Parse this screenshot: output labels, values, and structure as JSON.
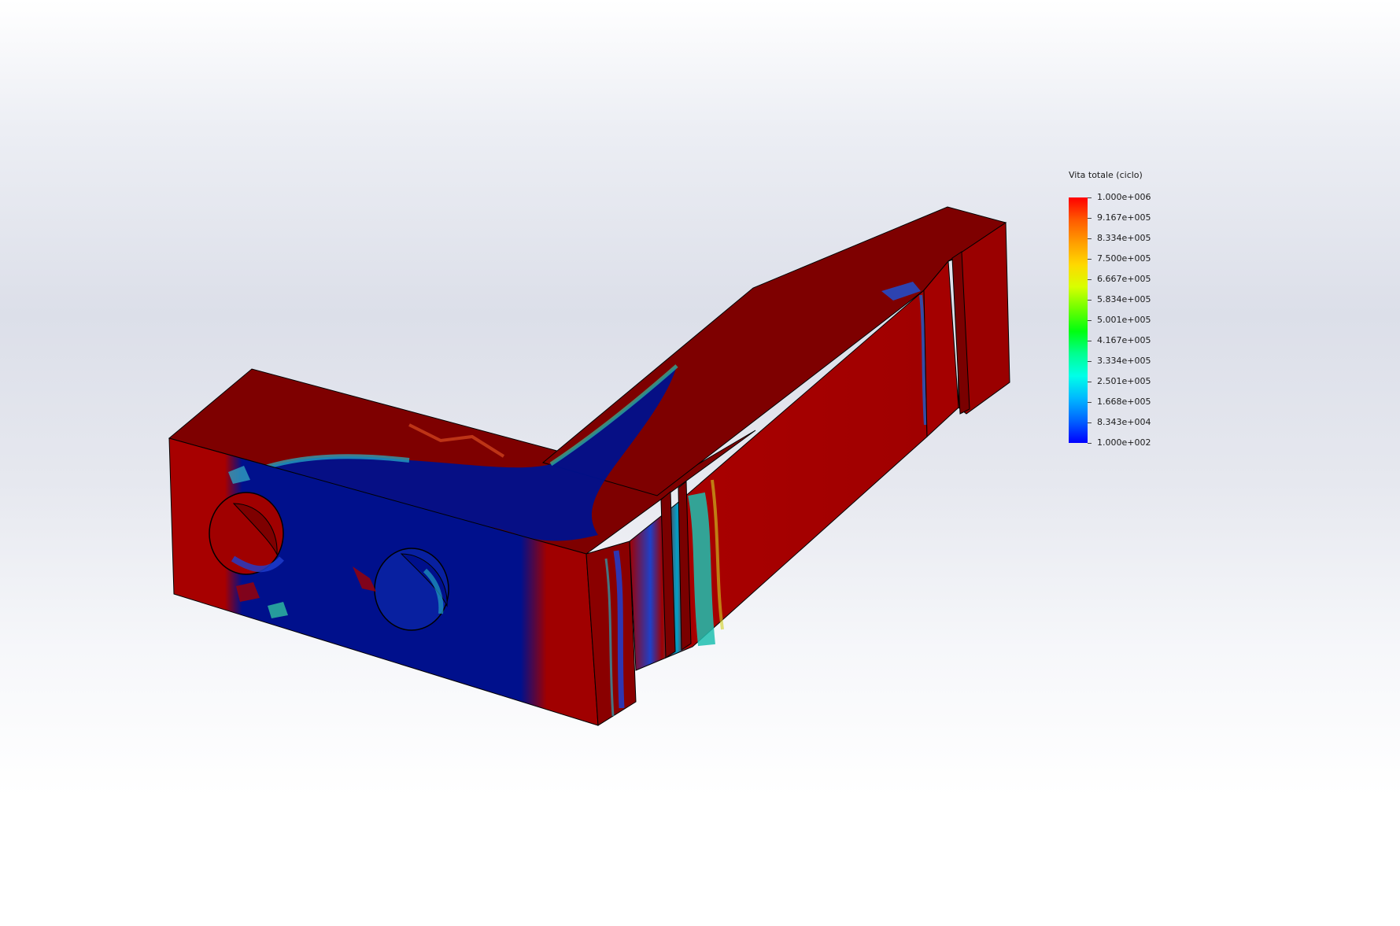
{
  "legend": {
    "title": "Vita totale (ciclo)",
    "labels": [
      "1.000e+006",
      "9.167e+005",
      "8.334e+005",
      "7.500e+005",
      "6.667e+005",
      "5.834e+005",
      "5.001e+005",
      "4.167e+005",
      "3.334e+005",
      "2.501e+005",
      "1.668e+005",
      "8.343e+004",
      "1.000e+002"
    ],
    "colors": {
      "max": "#ff0000",
      "min": "#0000ff"
    }
  },
  "model": {
    "colors": {
      "red_face": "#a80000",
      "dark_red_face": "#7e0000",
      "blue_face": "#00108a",
      "edge": "#000000"
    }
  }
}
